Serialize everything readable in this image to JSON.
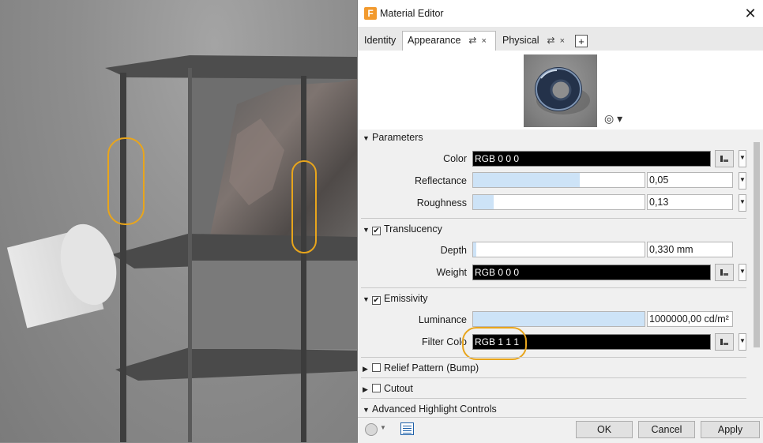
{
  "window": {
    "title": "Material Editor",
    "app_icon": "F",
    "close_glyph": "✕"
  },
  "tabs": [
    {
      "label": "Identity"
    },
    {
      "label": "Appearance",
      "icon": "⇄",
      "close": "×"
    },
    {
      "label": "Physical",
      "icon": "⇄",
      "close": "×"
    }
  ],
  "add_tab_glyph": "+",
  "preview": {
    "menu_icon": "spiral-icon",
    "menu_glyph": "◎ ▾"
  },
  "sections": {
    "parameters": {
      "label": "Parameters",
      "color": {
        "label": "Color",
        "value": "RGB 0 0 0"
      },
      "reflectance": {
        "label": "Reflectance",
        "value": "0,05",
        "level": 0.05
      },
      "roughness": {
        "label": "Roughness",
        "value": "0,13",
        "level": 0.13
      }
    },
    "translucency": {
      "label": "Translucency",
      "checked": true,
      "depth": {
        "label": "Depth",
        "value": "0,330 mm"
      },
      "weight": {
        "label": "Weight",
        "value": "RGB 0 0 0"
      }
    },
    "emissivity": {
      "label": "Emissivity",
      "checked": true,
      "luminance": {
        "label": "Luminance",
        "value": "1000000,00 cd/m²"
      },
      "filter_color": {
        "label": "Filter Colo",
        "value": "RGB 1 1 1"
      }
    },
    "relief": {
      "label": "Relief Pattern (Bump)",
      "checked": false
    },
    "cutout": {
      "label": "Cutout",
      "checked": false
    },
    "advanced": {
      "label": "Advanced Highlight Controls"
    }
  },
  "buttons": {
    "ok": "OK",
    "cancel": "Cancel",
    "apply": "Apply"
  },
  "colors": {
    "highlight": "#e8a51c",
    "slider_fill": "#cde3f7",
    "app_icon_bg": "#f29a2e"
  }
}
